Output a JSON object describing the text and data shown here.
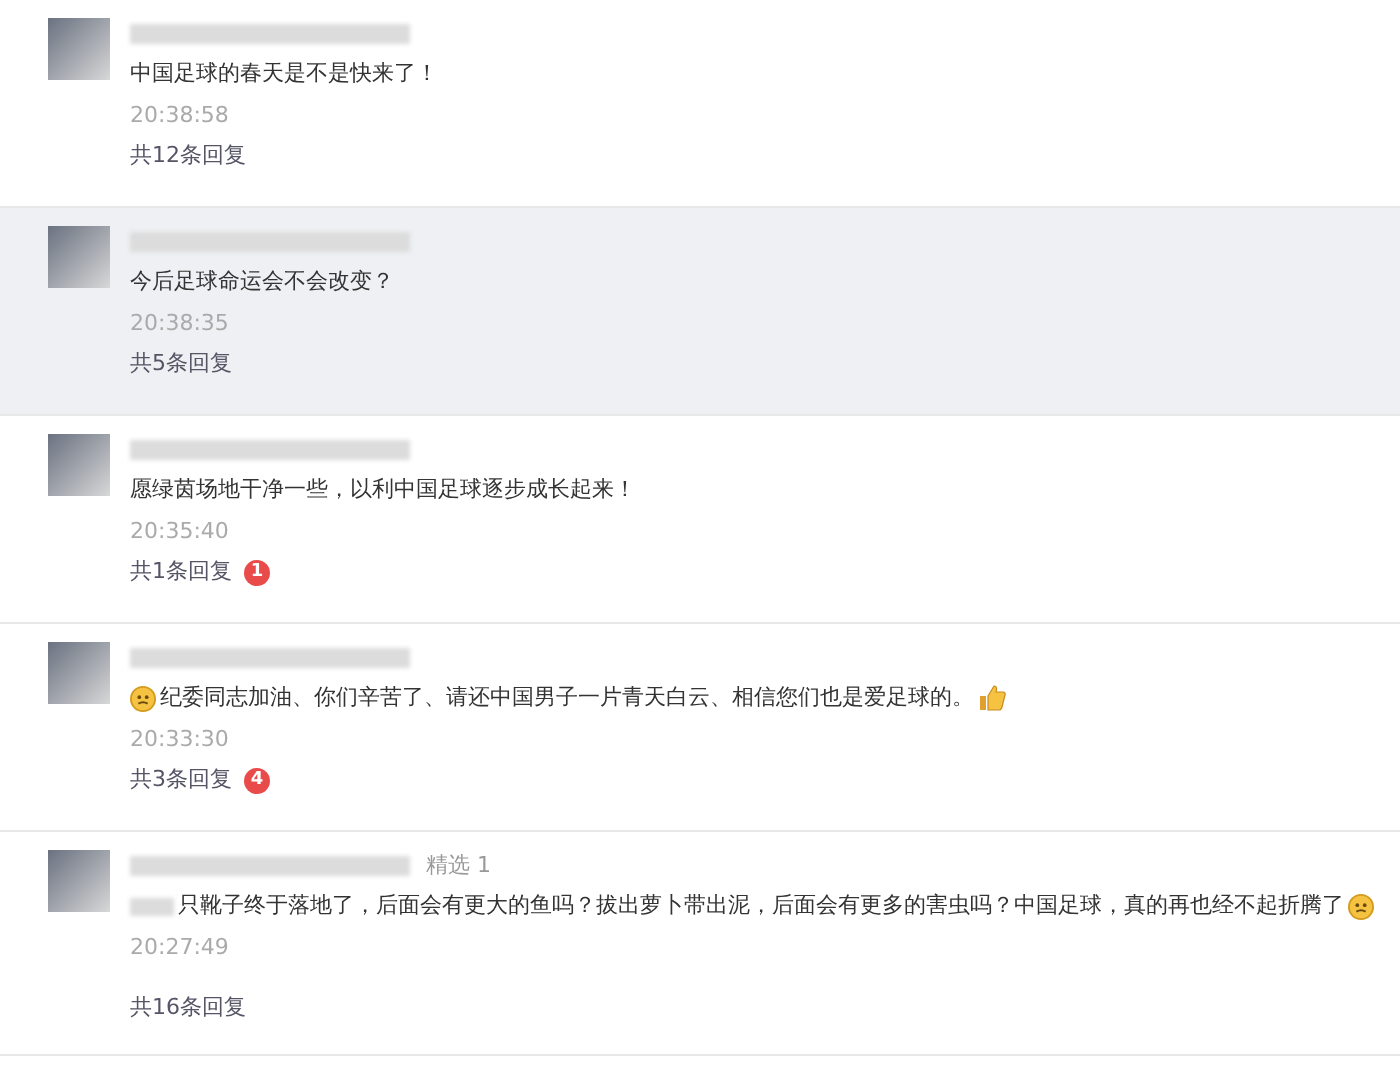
{
  "comments": [
    {
      "highlighted": false,
      "parts": [
        {
          "kind": "text",
          "text": "中国足球的春天是不是快来了！"
        }
      ],
      "time": "20:38:58",
      "replies": "共12条回复"
    },
    {
      "highlighted": true,
      "parts": [
        {
          "kind": "text",
          "text": "今后足球命运会不会改变？"
        }
      ],
      "time": "20:38:35",
      "replies": "共5条回复"
    },
    {
      "highlighted": false,
      "parts": [
        {
          "kind": "text",
          "text": "愿绿茵场地干净一些，以利中国足球逐步成长起来！"
        }
      ],
      "time": "20:35:40",
      "replies": "共1条回复",
      "badge": "1"
    },
    {
      "highlighted": false,
      "parts": [
        {
          "kind": "emoji"
        },
        {
          "kind": "text",
          "text": "纪委同志加油、你们辛苦了、请还中国男子一片青天白云、相信您们也是爱足球的。"
        },
        {
          "kind": "thumbs-up"
        }
      ],
      "time": "20:33:30",
      "replies": "共3条回复",
      "badge": "4"
    },
    {
      "highlighted": false,
      "tag": "精选 1",
      "parts": [
        {
          "kind": "blur"
        },
        {
          "kind": "text",
          "text": "只靴子终于落地了，后面会有更大的鱼吗？拔出萝卜带出泥，后面会有更多的害虫吗？中国足球，真的再也经不起折腾了"
        },
        {
          "kind": "emoji"
        }
      ],
      "time": "20:27:49",
      "replies": "共16条回复"
    }
  ]
}
